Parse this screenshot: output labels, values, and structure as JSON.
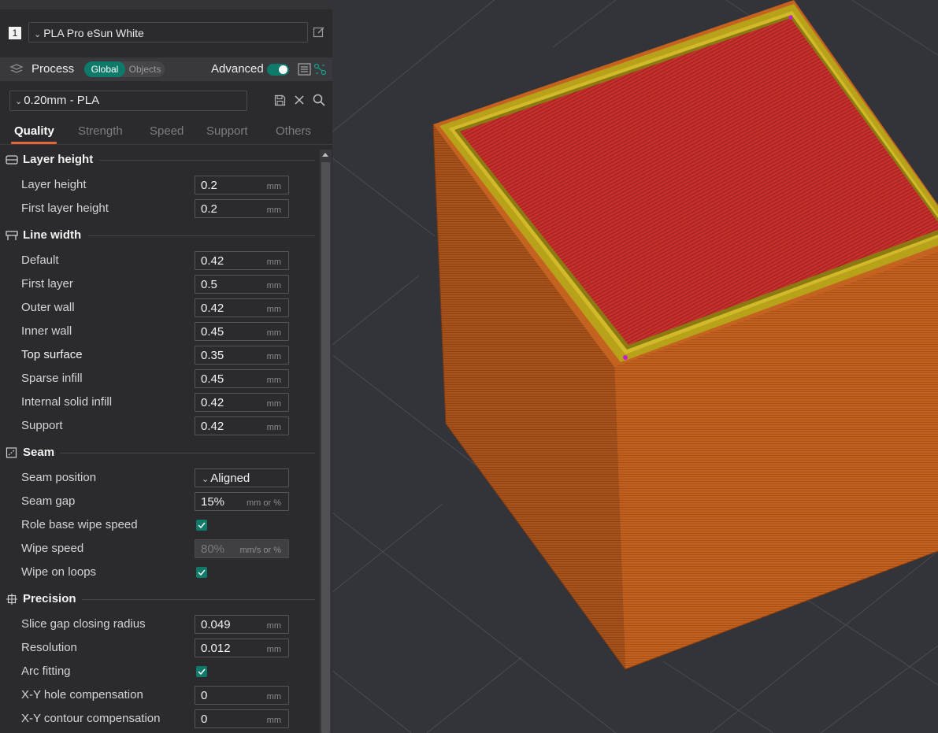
{
  "filament": {
    "index": "1",
    "name": "PLA Pro eSun White"
  },
  "process": {
    "label": "Process",
    "scope_global": "Global",
    "scope_objects": "Objects",
    "advanced_label": "Advanced",
    "advanced_on": true
  },
  "preset": {
    "name": "0.20mm - PLA"
  },
  "tabs": [
    "Quality",
    "Strength",
    "Speed",
    "Support",
    "Others"
  ],
  "active_tab": "Quality",
  "sections": {
    "layer_height": {
      "title": "Layer height",
      "rows": [
        {
          "label": "Layer height",
          "value": "0.2",
          "unit": "mm"
        },
        {
          "label": "First layer height",
          "value": "0.2",
          "unit": "mm"
        }
      ]
    },
    "line_width": {
      "title": "Line width",
      "rows": [
        {
          "label": "Default",
          "value": "0.42",
          "unit": "mm"
        },
        {
          "label": "First layer",
          "value": "0.5",
          "unit": "mm"
        },
        {
          "label": "Outer wall",
          "value": "0.42",
          "unit": "mm"
        },
        {
          "label": "Inner wall",
          "value": "0.45",
          "unit": "mm"
        },
        {
          "label": "Top surface",
          "value": "0.35",
          "unit": "mm"
        },
        {
          "label": "Sparse infill",
          "value": "0.45",
          "unit": "mm"
        },
        {
          "label": "Internal solid infill",
          "value": "0.42",
          "unit": "mm"
        },
        {
          "label": "Support",
          "value": "0.42",
          "unit": "mm"
        }
      ]
    },
    "seam": {
      "title": "Seam",
      "seam_position": {
        "label": "Seam position",
        "value": "Aligned"
      },
      "seam_gap": {
        "label": "Seam gap",
        "value": "15%",
        "unit": "mm or %"
      },
      "role_base_wipe_speed": {
        "label": "Role base wipe speed",
        "checked": true
      },
      "wipe_speed": {
        "label": "Wipe speed",
        "value": "80%",
        "unit": "mm/s or %"
      },
      "wipe_on_loops": {
        "label": "Wipe on loops",
        "checked": true
      }
    },
    "precision": {
      "title": "Precision",
      "slice_gap": {
        "label": "Slice gap closing radius",
        "value": "0.049",
        "unit": "mm"
      },
      "resolution": {
        "label": "Resolution",
        "value": "0.012",
        "unit": "mm"
      },
      "arc_fitting": {
        "label": "Arc fitting",
        "checked": true
      },
      "xy_hole": {
        "label": "X-Y hole compensation",
        "value": "0",
        "unit": "mm"
      },
      "xy_contour": {
        "label": "X-Y contour compensation",
        "value": "0",
        "unit": "mm"
      }
    }
  },
  "colors": {
    "accent": "#0e7a6a",
    "tab_underline": "#e5663a",
    "panel_bg": "#2b2b2e",
    "viewport_bg": "#33333a",
    "cube_side": "#c4621f",
    "cube_top": "#c8302d",
    "top_perimeter": "#b8a21a"
  }
}
